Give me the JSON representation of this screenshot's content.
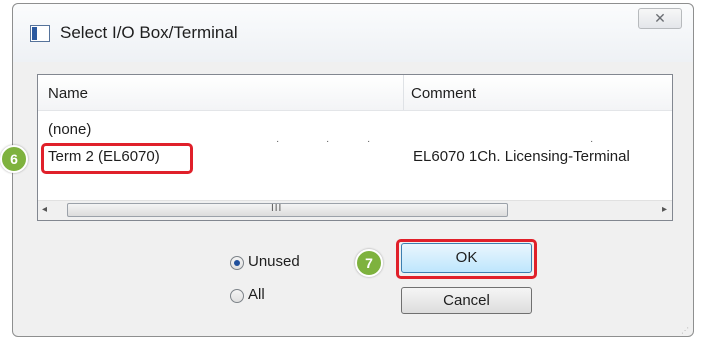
{
  "dialog": {
    "title": "Select I/O Box/Terminal",
    "close_glyph": "✕",
    "list": {
      "columns": [
        "Name",
        "Comment"
      ],
      "rows": [
        {
          "name": "(none)",
          "comment": ""
        },
        {
          "name": "Term 2 (EL6070)",
          "comment": "EL6070 1Ch. Licensing-Terminal"
        }
      ],
      "scrollbar": {
        "left_arrow": "◂",
        "right_arrow": "▸",
        "grip": "III"
      }
    },
    "options": {
      "unused_label": "Unused",
      "all_label": "All",
      "selected": "Unused"
    },
    "buttons": {
      "ok_label": "OK",
      "cancel_label": "Cancel"
    }
  },
  "annotations": {
    "step_6": "6",
    "step_7": "7",
    "highlight_color": "#e0202a",
    "badge_color": "#7eb23e"
  }
}
